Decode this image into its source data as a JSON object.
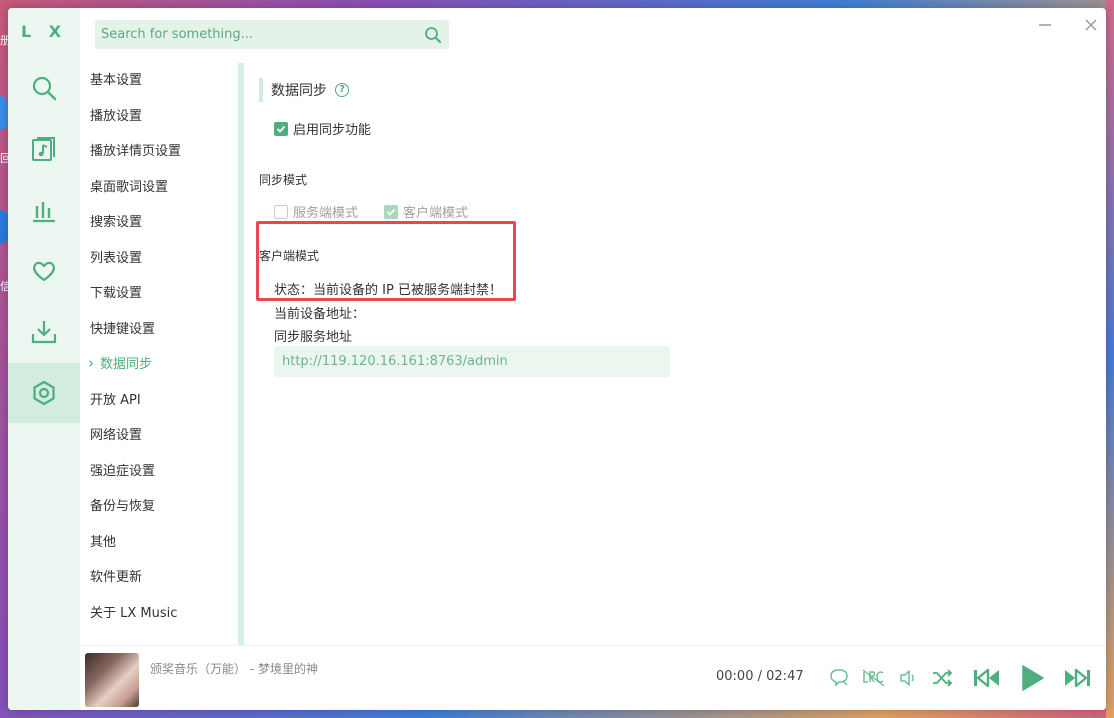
{
  "app": {
    "logo": "L X"
  },
  "search": {
    "placeholder": "Search for something..."
  },
  "rail": [
    {
      "name": "search",
      "icon": "search-icon"
    },
    {
      "name": "songlist",
      "icon": "music-list-icon"
    },
    {
      "name": "leaderboard",
      "icon": "chart-bars-icon"
    },
    {
      "name": "favorite",
      "icon": "heart-icon"
    },
    {
      "name": "download",
      "icon": "download-icon"
    },
    {
      "name": "settings",
      "icon": "settings-icon",
      "active": true
    }
  ],
  "nav": {
    "items": [
      "基本设置",
      "播放设置",
      "播放详情页设置",
      "桌面歌词设置",
      "搜索设置",
      "列表设置",
      "下载设置",
      "快捷键设置",
      "数据同步",
      "开放 API",
      "网络设置",
      "强迫症设置",
      "备份与恢复",
      "其他",
      "软件更新",
      "关于 LX Music"
    ],
    "active_index": 8
  },
  "sync": {
    "title": "数据同步",
    "help": "?",
    "enable_label": "启用同步功能",
    "mode_label": "同步模式",
    "server_mode": "服务端模式",
    "client_mode": "客户端模式",
    "client_section": "客户端模式",
    "status": "状态：当前设备的 IP 已被服务端封禁！",
    "device_addr_label": "当前设备地址：",
    "server_addr_label": "同步服务地址",
    "server_addr_value": "http://119.120.16.161:8763/admin"
  },
  "player": {
    "track": "颁奖音乐（万能） - 梦境里的神",
    "current": "00:00",
    "separator": "/",
    "total": "02:47",
    "colors": {
      "accent": "#4caf7d"
    }
  },
  "desktop": {
    "labels": [
      "册",
      "回",
      "信"
    ]
  }
}
